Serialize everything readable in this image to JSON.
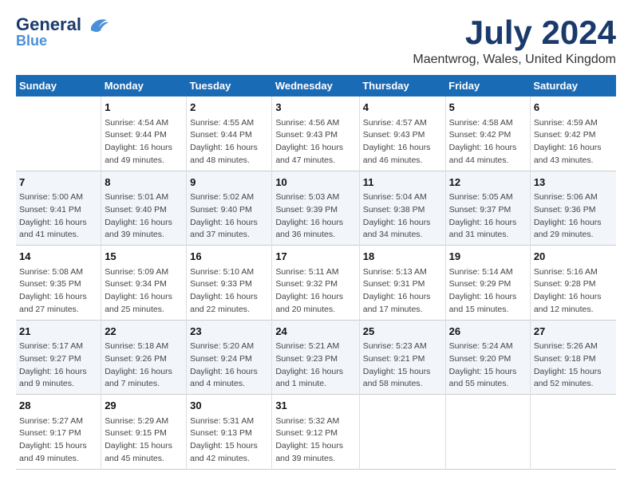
{
  "logo": {
    "line1": "General",
    "line2": "Blue"
  },
  "title": "July 2024",
  "location": "Maentwrog, Wales, United Kingdom",
  "days_header": [
    "Sunday",
    "Monday",
    "Tuesday",
    "Wednesday",
    "Thursday",
    "Friday",
    "Saturday"
  ],
  "weeks": [
    [
      {
        "day": "",
        "info": ""
      },
      {
        "day": "1",
        "info": "Sunrise: 4:54 AM\nSunset: 9:44 PM\nDaylight: 16 hours\nand 49 minutes."
      },
      {
        "day": "2",
        "info": "Sunrise: 4:55 AM\nSunset: 9:44 PM\nDaylight: 16 hours\nand 48 minutes."
      },
      {
        "day": "3",
        "info": "Sunrise: 4:56 AM\nSunset: 9:43 PM\nDaylight: 16 hours\nand 47 minutes."
      },
      {
        "day": "4",
        "info": "Sunrise: 4:57 AM\nSunset: 9:43 PM\nDaylight: 16 hours\nand 46 minutes."
      },
      {
        "day": "5",
        "info": "Sunrise: 4:58 AM\nSunset: 9:42 PM\nDaylight: 16 hours\nand 44 minutes."
      },
      {
        "day": "6",
        "info": "Sunrise: 4:59 AM\nSunset: 9:42 PM\nDaylight: 16 hours\nand 43 minutes."
      }
    ],
    [
      {
        "day": "7",
        "info": "Sunrise: 5:00 AM\nSunset: 9:41 PM\nDaylight: 16 hours\nand 41 minutes."
      },
      {
        "day": "8",
        "info": "Sunrise: 5:01 AM\nSunset: 9:40 PM\nDaylight: 16 hours\nand 39 minutes."
      },
      {
        "day": "9",
        "info": "Sunrise: 5:02 AM\nSunset: 9:40 PM\nDaylight: 16 hours\nand 37 minutes."
      },
      {
        "day": "10",
        "info": "Sunrise: 5:03 AM\nSunset: 9:39 PM\nDaylight: 16 hours\nand 36 minutes."
      },
      {
        "day": "11",
        "info": "Sunrise: 5:04 AM\nSunset: 9:38 PM\nDaylight: 16 hours\nand 34 minutes."
      },
      {
        "day": "12",
        "info": "Sunrise: 5:05 AM\nSunset: 9:37 PM\nDaylight: 16 hours\nand 31 minutes."
      },
      {
        "day": "13",
        "info": "Sunrise: 5:06 AM\nSunset: 9:36 PM\nDaylight: 16 hours\nand 29 minutes."
      }
    ],
    [
      {
        "day": "14",
        "info": "Sunrise: 5:08 AM\nSunset: 9:35 PM\nDaylight: 16 hours\nand 27 minutes."
      },
      {
        "day": "15",
        "info": "Sunrise: 5:09 AM\nSunset: 9:34 PM\nDaylight: 16 hours\nand 25 minutes."
      },
      {
        "day": "16",
        "info": "Sunrise: 5:10 AM\nSunset: 9:33 PM\nDaylight: 16 hours\nand 22 minutes."
      },
      {
        "day": "17",
        "info": "Sunrise: 5:11 AM\nSunset: 9:32 PM\nDaylight: 16 hours\nand 20 minutes."
      },
      {
        "day": "18",
        "info": "Sunrise: 5:13 AM\nSunset: 9:31 PM\nDaylight: 16 hours\nand 17 minutes."
      },
      {
        "day": "19",
        "info": "Sunrise: 5:14 AM\nSunset: 9:29 PM\nDaylight: 16 hours\nand 15 minutes."
      },
      {
        "day": "20",
        "info": "Sunrise: 5:16 AM\nSunset: 9:28 PM\nDaylight: 16 hours\nand 12 minutes."
      }
    ],
    [
      {
        "day": "21",
        "info": "Sunrise: 5:17 AM\nSunset: 9:27 PM\nDaylight: 16 hours\nand 9 minutes."
      },
      {
        "day": "22",
        "info": "Sunrise: 5:18 AM\nSunset: 9:26 PM\nDaylight: 16 hours\nand 7 minutes."
      },
      {
        "day": "23",
        "info": "Sunrise: 5:20 AM\nSunset: 9:24 PM\nDaylight: 16 hours\nand 4 minutes."
      },
      {
        "day": "24",
        "info": "Sunrise: 5:21 AM\nSunset: 9:23 PM\nDaylight: 16 hours\nand 1 minute."
      },
      {
        "day": "25",
        "info": "Sunrise: 5:23 AM\nSunset: 9:21 PM\nDaylight: 15 hours\nand 58 minutes."
      },
      {
        "day": "26",
        "info": "Sunrise: 5:24 AM\nSunset: 9:20 PM\nDaylight: 15 hours\nand 55 minutes."
      },
      {
        "day": "27",
        "info": "Sunrise: 5:26 AM\nSunset: 9:18 PM\nDaylight: 15 hours\nand 52 minutes."
      }
    ],
    [
      {
        "day": "28",
        "info": "Sunrise: 5:27 AM\nSunset: 9:17 PM\nDaylight: 15 hours\nand 49 minutes."
      },
      {
        "day": "29",
        "info": "Sunrise: 5:29 AM\nSunset: 9:15 PM\nDaylight: 15 hours\nand 45 minutes."
      },
      {
        "day": "30",
        "info": "Sunrise: 5:31 AM\nSunset: 9:13 PM\nDaylight: 15 hours\nand 42 minutes."
      },
      {
        "day": "31",
        "info": "Sunrise: 5:32 AM\nSunset: 9:12 PM\nDaylight: 15 hours\nand 39 minutes."
      },
      {
        "day": "",
        "info": ""
      },
      {
        "day": "",
        "info": ""
      },
      {
        "day": "",
        "info": ""
      }
    ]
  ]
}
